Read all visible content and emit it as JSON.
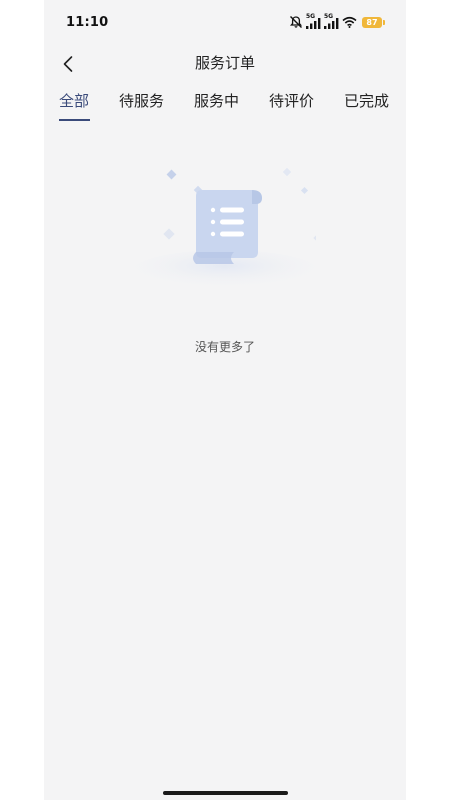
{
  "status_bar": {
    "time": "11:10",
    "network_1": "5G",
    "network_2": "5G",
    "battery": "87"
  },
  "nav": {
    "title": "服务订单"
  },
  "tabs": [
    {
      "label": "全部",
      "active": true
    },
    {
      "label": "待服务",
      "active": false
    },
    {
      "label": "服务中",
      "active": false
    },
    {
      "label": "待评价",
      "active": false
    },
    {
      "label": "已完成",
      "active": false
    }
  ],
  "empty_state": {
    "message": "没有更多了",
    "icon": "empty-list-icon"
  },
  "colors": {
    "accent": "#3a4a7a",
    "background": "#f4f4f5",
    "battery": "#f0b73a",
    "illustration": "#c9d6ef"
  }
}
